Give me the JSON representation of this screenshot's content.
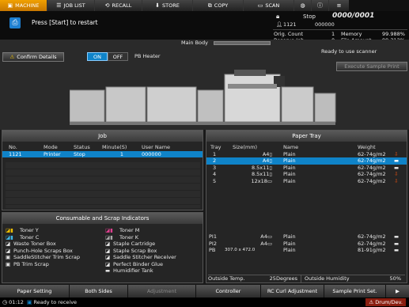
{
  "tabs": [
    {
      "label": "MACHINE",
      "icon": "machine-icon"
    },
    {
      "label": "JOB LIST",
      "icon": "joblist-icon"
    },
    {
      "label": "RECALL",
      "icon": "recall-icon"
    },
    {
      "label": "STORE",
      "icon": "store-icon"
    },
    {
      "label": "COPY",
      "icon": "copy-icon"
    },
    {
      "label": "SCAN",
      "icon": "scan-icon"
    }
  ],
  "message": "Press [Start] to restart",
  "status": {
    "state": "Stop",
    "counter": "0000/0001",
    "user": "1121",
    "user_code": "000000",
    "orig_count_label": "Orig. Count",
    "orig_count_value": "1",
    "memory_label": "Memory",
    "memory_value": "99.988%",
    "reserve_job_label": "Reserve Job",
    "reserve_job_value": "0",
    "file_amount_label": "File Amount",
    "file_amount_value": "99.312%",
    "ready_text": "Ready to use scanner",
    "execute_sample_print": "Execute Sample Print"
  },
  "main_body_label": "Main Body",
  "confirm_details": "Confirm Details",
  "pb_heater": {
    "on": "ON",
    "off": "OFF",
    "label": "PB Heater"
  },
  "job": {
    "title": "Job",
    "headers": [
      "No.",
      "Mode",
      "Status",
      "Minute(S)",
      "User Name"
    ],
    "rows": [
      [
        "1121",
        "Printer",
        "Stop",
        "1",
        "000000"
      ]
    ]
  },
  "paper_tray": {
    "title": "Paper Tray",
    "headers": [
      "Tray",
      "Size(mm)",
      "Name",
      "Weight"
    ],
    "rows": [
      [
        "1",
        "A4▯",
        "Plain",
        "62-74g/m2"
      ],
      [
        "2",
        "A4▯",
        "Plain",
        "62-74g/m2"
      ],
      [
        "3",
        "8.5x11▯",
        "Plain",
        "62-74g/m2"
      ],
      [
        "4",
        "8.5x11▯",
        "Plain",
        "62-74g/m2"
      ],
      [
        "5",
        "12x18▭",
        "Plain",
        "62-74g/m2"
      ]
    ],
    "lower_rows": [
      [
        "PI1",
        "A4▭",
        "Plain",
        "62-74g/m2"
      ],
      [
        "PI2",
        "A4▭",
        "Plain",
        "62-74g/m2"
      ],
      [
        "PB",
        "307.0 x 472.0",
        "Plain",
        "81-91g/m2"
      ]
    ],
    "outside_temp_label": "Outside Temp.",
    "outside_temp_value": "25Degrees",
    "outside_humidity_label": "Outside Humidity",
    "outside_humidity_value": "50%"
  },
  "consumables": {
    "title": "Consumable and Scrap Indicators",
    "left": [
      "Toner Y",
      "Toner C",
      "Waste Toner Box",
      "Punch-Hole Scraps Box",
      "SaddleStitcher Trim Scrap",
      "PB Trim Scrap"
    ],
    "right": [
      "Toner M",
      "Toner K",
      "Staple Cartridge",
      "Staple Scrap Box",
      "Saddle Stitcher Receiver",
      "Perfect Binder Glue",
      "Humidifier Tank"
    ]
  },
  "footer": {
    "paper_setting": "Paper Setting",
    "both_sides": "Both Sides",
    "adjustment": "Adjustment",
    "controller": "Controller",
    "rc_curl": "RC Curl Adjustment",
    "sample_print": "Sample Print Set."
  },
  "bottom": {
    "time": "01:12",
    "ready": "Ready to receive",
    "drum_dev": "Drum/Dev."
  },
  "colors": {
    "accent": "#e88a00",
    "select": "#0f83c8",
    "warning": "#f0c000",
    "alert": "#d04010"
  }
}
